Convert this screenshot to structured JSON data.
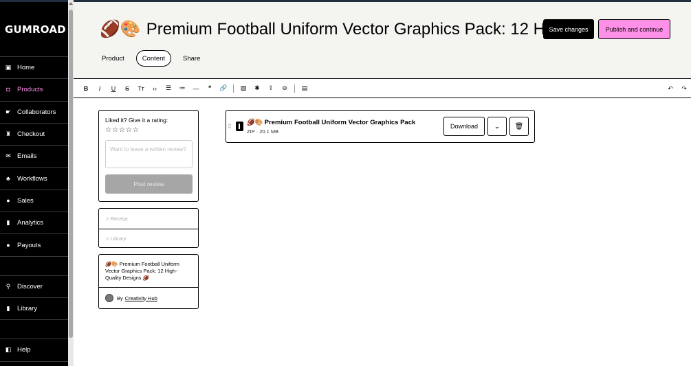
{
  "sidebar": {
    "logo": "GUMROAD",
    "items": [
      {
        "label": "Home",
        "icon": "home-icon",
        "glyph": "▣"
      },
      {
        "label": "Products",
        "icon": "products-icon",
        "glyph": "◘"
      },
      {
        "label": "Collaborators",
        "icon": "collaborators-icon",
        "glyph": "☛"
      },
      {
        "label": "Checkout",
        "icon": "cart-icon",
        "glyph": "♜"
      },
      {
        "label": "Emails",
        "icon": "envelope-icon",
        "glyph": "✉"
      },
      {
        "label": "Workflows",
        "icon": "workflows-icon",
        "glyph": "♣"
      },
      {
        "label": "Sales",
        "icon": "sales-icon",
        "glyph": "●"
      },
      {
        "label": "Analytics",
        "icon": "analytics-icon",
        "glyph": "▮"
      },
      {
        "label": "Payouts",
        "icon": "payouts-icon",
        "glyph": "●"
      }
    ],
    "bottom_items": [
      {
        "label": "Discover",
        "icon": "search-icon",
        "glyph": "⚲"
      },
      {
        "label": "Library",
        "icon": "bookmark-icon",
        "glyph": "▮"
      },
      {
        "label": "Help",
        "icon": "help-icon",
        "glyph": "◧"
      }
    ],
    "active_color": "#ff90e8"
  },
  "header": {
    "emojis": "🏈🎨",
    "title": "Premium Football Uniform Vector Graphics Pack: 12 Hi...",
    "save_label": "Save changes",
    "publish_label": "Publish and continue",
    "tabs": [
      {
        "label": "Product",
        "active": false
      },
      {
        "label": "Content",
        "active": true
      },
      {
        "label": "Share",
        "active": false
      }
    ]
  },
  "toolbar": {
    "buttons": [
      {
        "name": "bold-icon",
        "glyph": "B"
      },
      {
        "name": "italic-icon",
        "glyph": "I"
      },
      {
        "name": "underline-icon",
        "glyph": "U"
      },
      {
        "name": "strikethrough-icon",
        "glyph": "S"
      },
      {
        "name": "text-size-icon",
        "glyph": "Tт"
      },
      {
        "name": "code-icon",
        "glyph": "‹›"
      },
      {
        "name": "bullet-list-icon",
        "glyph": "☰"
      },
      {
        "name": "numbered-list-icon",
        "glyph": "≔"
      },
      {
        "name": "horizontal-rule-icon",
        "glyph": "—"
      },
      {
        "name": "quote-icon",
        "glyph": "❝"
      },
      {
        "name": "link-icon",
        "glyph": "🔗"
      },
      {
        "name": "image-icon",
        "glyph": "▨"
      },
      {
        "name": "embed-icon",
        "glyph": "✱"
      },
      {
        "name": "upload-icon",
        "glyph": "⇪"
      },
      {
        "name": "more-icon",
        "glyph": "⊖"
      },
      {
        "name": "page-icon",
        "glyph": "▤"
      }
    ],
    "undo_glyph": "↶",
    "redo_glyph": "↷"
  },
  "review": {
    "title": "Liked it? Give it a rating:",
    "stars": "☆☆☆☆☆",
    "placeholder": "Want to leave a written review?",
    "post_label": "Post review"
  },
  "links": [
    {
      "label": "> Receipt"
    },
    {
      "label": "> Library"
    }
  ],
  "product_card": {
    "name": "🏈🎨 Premium Football Uniform Vector Graphics Pack: 12 High-Quality Designs 🏈",
    "by": "By",
    "creator": "Creativity Hub"
  },
  "file": {
    "emojis": "🏈🎨",
    "name": "Premium Football Uniform Vector Graphics Pack",
    "meta": "ZIP · 20.1 MB",
    "download_label": "Download",
    "chevron_glyph": "⌄",
    "trash_glyph": "🗑"
  }
}
